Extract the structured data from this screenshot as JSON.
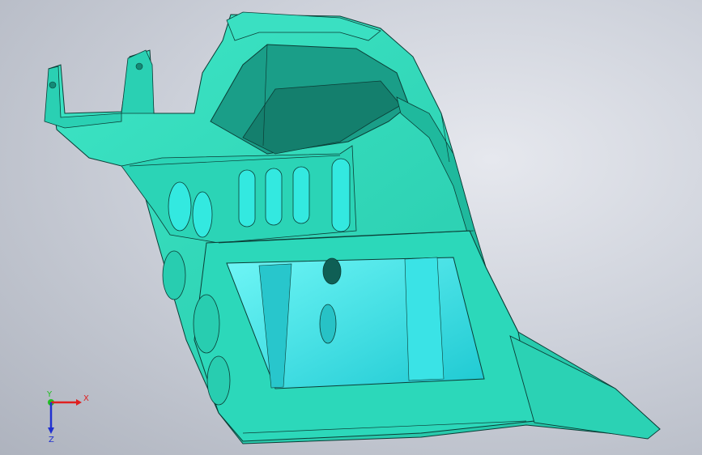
{
  "viewport": {
    "background_top": "#e6e8ee",
    "background_bottom": "#aeb3be"
  },
  "model": {
    "name": "part-model",
    "body_color": "#2fd6b8",
    "shade_color": "#1fb39a",
    "dark_color": "#138a76",
    "panel_color": "#33eef0",
    "edge_color": "#0b3d36"
  },
  "triad": {
    "x_label": "X",
    "y_label": "Y",
    "z_label": "Z",
    "x_color": "#e02020",
    "y_color": "#20c020",
    "z_color": "#2030d0"
  }
}
